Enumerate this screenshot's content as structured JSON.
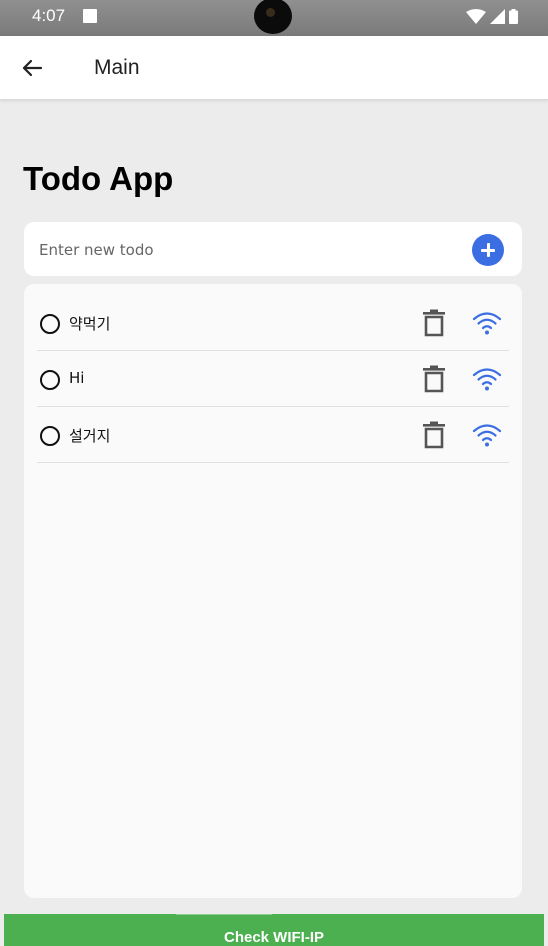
{
  "status_bar": {
    "time": "4:07",
    "icons": [
      "notification-box-icon",
      "camera-cutout",
      "wifi-icon",
      "signal-icon",
      "battery-icon"
    ]
  },
  "app_bar": {
    "back_icon": "arrow-left-icon",
    "title": "Main"
  },
  "main": {
    "title": "Todo App",
    "input": {
      "value": "",
      "placeholder": "Enter new todo",
      "add_icon": "plus-circle-icon"
    },
    "todos": [
      {
        "text": "약먹기",
        "done": false
      },
      {
        "text": "Hi",
        "done": false
      },
      {
        "text": "설거지",
        "done": false
      }
    ]
  },
  "bottom_button": {
    "label": "Check WIFI-IP"
  },
  "colors": {
    "accent": "#3c6ee3",
    "wifi_icon": "#3c6ee3",
    "bottom_button": "#4caf50",
    "background": "#ececec",
    "card": "#ffffff"
  }
}
